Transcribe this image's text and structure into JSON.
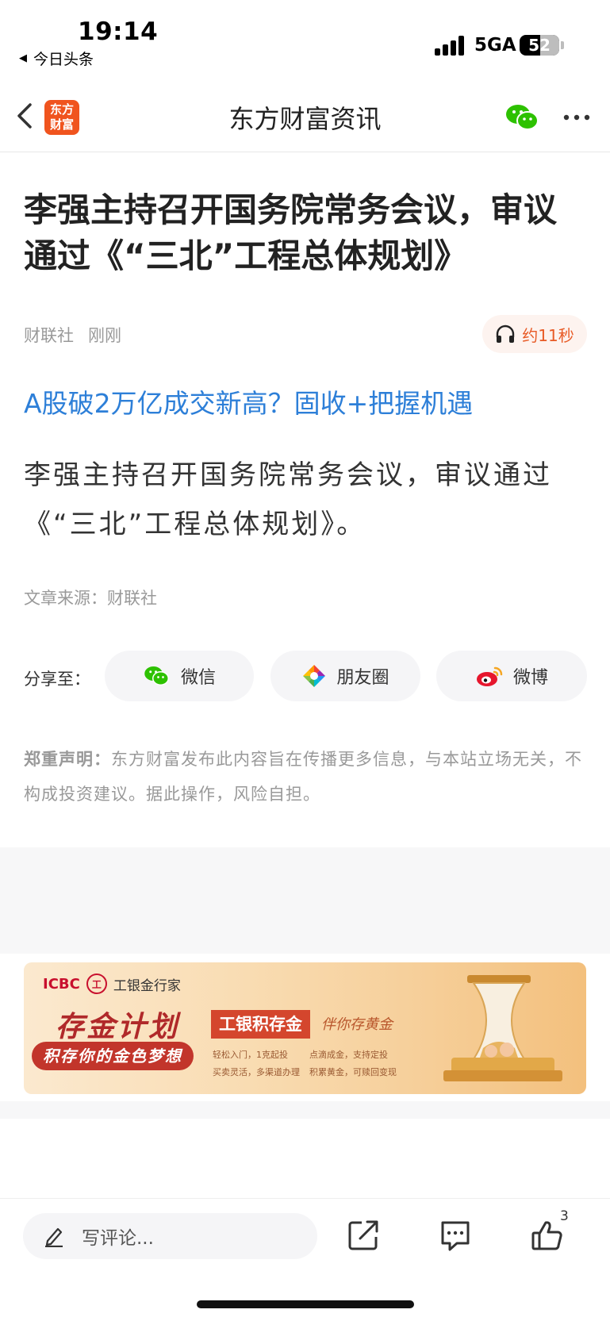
{
  "status_bar": {
    "time": "19:14",
    "back_app": "今日头条",
    "network": "5GA",
    "battery": "52"
  },
  "header": {
    "logo_text": "东方财富",
    "title": "东方财富资讯"
  },
  "article": {
    "title": "李强主持召开国务院常务会议，审议通过《“三北”工程总体规划》",
    "source_name": "财联社",
    "time_ago": "刚刚",
    "audio_duration": "约11秒",
    "promo_link": "A股破2万亿成交新高？固收+把握机遇",
    "body": "李强主持召开国务院常务会议，审议通过《“三北”工程总体规划》。",
    "source_line": "文章来源：财联社"
  },
  "share": {
    "label": "分享至：",
    "wechat": "微信",
    "moments": "朋友圈",
    "weibo": "微博"
  },
  "disclaimer": {
    "label": "郑重声明：",
    "text": "东方财富发布此内容旨在传播更多信息，与本站立场无关，不构成投资建议。据此操作，风险自担。"
  },
  "ad": {
    "brand": "ICBC",
    "brand_mark": "工",
    "bank_name": "工银金行家",
    "headline": "存金计划",
    "subline": "积存你的金色梦想",
    "tag": "工银积存金",
    "tagline": "伴你存黄金",
    "features": [
      "轻松入门，1克起投",
      "点滴成金，支持定投",
      "买卖灵活，多渠道办理",
      "积累黄金，可赎回变现"
    ]
  },
  "bottom_bar": {
    "comment_placeholder": "写评论...",
    "like_count": "3"
  },
  "colors": {
    "accent_blue": "#2d7fd8",
    "brand_orange": "#f0541e",
    "audio_orange": "#e85a25",
    "wechat_green": "#2dc100"
  }
}
